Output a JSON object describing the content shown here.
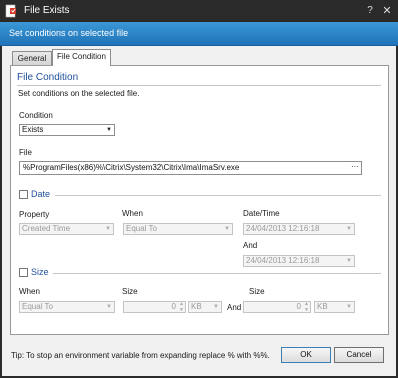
{
  "window": {
    "title": "File Exists",
    "help_glyph": "?",
    "close_glyph": "✕",
    "banner": "Set conditions on selected file"
  },
  "tabs": [
    {
      "label": "General",
      "active": false
    },
    {
      "label": "File Condition",
      "active": true
    }
  ],
  "file_condition": {
    "section_title": "File Condition",
    "description": "Set conditions on the selected file.",
    "condition_label": "Condition",
    "condition_value": "Exists",
    "file_label": "File",
    "file_value": "%ProgramFiles(x86)%\\Citrix\\System32\\Citrix\\Ima\\ImaSrv.exe",
    "browse_glyph": "···"
  },
  "date_section": {
    "title": "Date",
    "checked": false,
    "property_label": "Property",
    "property_value": "Created Time",
    "when_label": "When",
    "when_value": "Equal To",
    "datetime_label": "Date/Time",
    "datetime_value": "24/04/2013 12:16:18",
    "and_label": "And",
    "and_value": "24/04/2013 12:16:18"
  },
  "size_section": {
    "title": "Size",
    "checked": false,
    "when_label": "When",
    "when_value": "Equal To",
    "size_label": "Size",
    "size_value": "0",
    "unit_value": "KB",
    "and_label": "And",
    "size2_label": "Size",
    "size2_value": "0",
    "unit2_value": "KB"
  },
  "footer": {
    "hint": "Tip: To stop an environment variable from expanding replace % with %%.",
    "ok_label": "OK",
    "cancel_label": "Cancel"
  },
  "colors": {
    "titlebar": "#2a2a2a",
    "banner_top": "#3b98d6",
    "banner_bottom": "#1f73b8",
    "section_title": "#1f4f9a"
  }
}
